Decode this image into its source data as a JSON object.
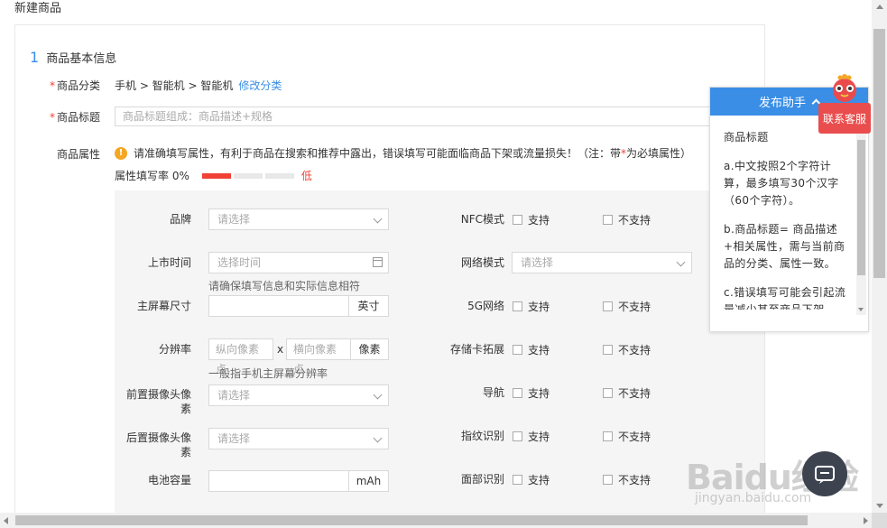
{
  "page": {
    "title": "新建商品"
  },
  "section": {
    "number": "1",
    "title": "商品基本信息"
  },
  "fields": {
    "category": {
      "required": "*",
      "label": "商品分类",
      "value": "手机 > 智能机 > 智能机",
      "link": "修改分类"
    },
    "title": {
      "required": "*",
      "label": "商品标题",
      "placeholder": "商品标题组成：商品描述+规格"
    },
    "attrs": {
      "label": "商品属性"
    }
  },
  "warning": {
    "icon": "exclamation-icon",
    "text_before": "请准确填写属性，有利于商品在搜索和推荐中露出，错误填写可能面临商品下架或流量损失！（注：带",
    "star": "*",
    "text_after": "为必填属性）"
  },
  "fill_rate": {
    "label": "属性填写率 0%",
    "level": "低",
    "value": 0,
    "segments_on": 1,
    "segments_total": 3
  },
  "left_attrs": {
    "brand": {
      "label": "品牌",
      "placeholder": "请选择"
    },
    "launch": {
      "label": "上市时间",
      "placeholder": "选择时间",
      "hint": "请确保填写信息和实际信息相符"
    },
    "screen": {
      "label": "主屏幕尺寸",
      "unit": "英寸"
    },
    "resolution": {
      "label": "分辨率",
      "placeholder_h": "纵向像素点",
      "x": "x",
      "placeholder_w": "横向像素点",
      "unit": "像素",
      "hint": "一般指手机主屏幕分辨率"
    },
    "front_cam": {
      "label_1": "前置摄像头像",
      "label_2": "素",
      "placeholder": "请选择"
    },
    "rear_cam": {
      "label_1": "后置摄像头像",
      "label_2": "素",
      "placeholder": "请选择"
    },
    "battery": {
      "label": "电池容量",
      "unit": "mAh"
    }
  },
  "right_attrs": {
    "yes": "支持",
    "no": "不支持",
    "nfc": "NFC模式",
    "network": {
      "label": "网络模式",
      "placeholder": "请选择"
    },
    "g5": "5G网络",
    "card": "存储卡拓展",
    "nav": "导航",
    "finger": "指纹识别",
    "face": "面部识别"
  },
  "helper": {
    "title": "发布助手",
    "heading": "商品标题",
    "tips": [
      "a.中文按照2个字符计算，最多填写30个汉字（60个字符）。",
      "b.商品标题= 商品描述+相关属性，需与当前商品的分类、属性一致。",
      "c.错误填写可能会引起流量减少甚至商品下架"
    ]
  },
  "contact": {
    "label": "联系客服"
  },
  "watermark": {
    "brand": "Baidu经验",
    "sub": "jingyan.baidu.com"
  },
  "colors": {
    "accent": "#3a8ee6",
    "danger": "#f04134",
    "warning": "#f5a623",
    "panel": "#f5f5f5"
  }
}
